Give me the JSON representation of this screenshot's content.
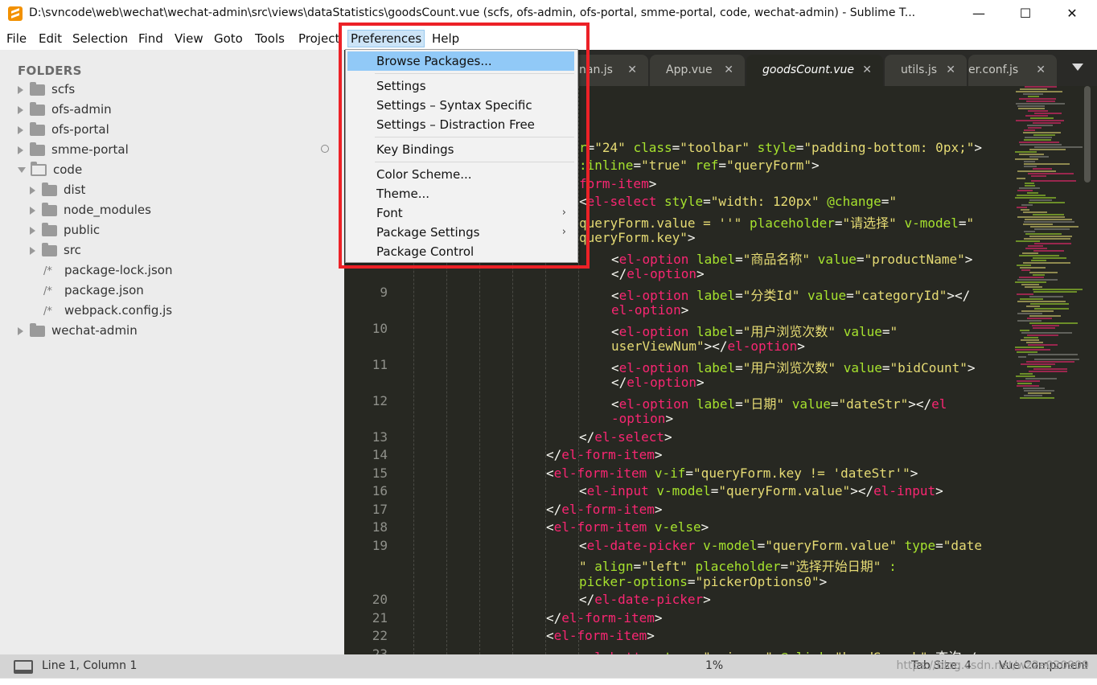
{
  "window": {
    "title": "D:\\svncode\\web\\wechat\\wechat-admin\\src\\views\\dataStatistics\\goodsCount.vue (scfs, ofs-admin, ofs-portal, smme-portal, code, wechat-admin) - Sublime T...",
    "minimize": "—",
    "maximize": "☐",
    "close": "✕"
  },
  "menubar": {
    "items": [
      "File",
      "Edit",
      "Selection",
      "Find",
      "View",
      "Goto",
      "Tools",
      "Project",
      "Preferences",
      "Help"
    ]
  },
  "sidebar": {
    "header": "FOLDERS",
    "items": [
      {
        "label": "scfs",
        "type": "folder"
      },
      {
        "label": "ofs-admin",
        "type": "folder"
      },
      {
        "label": "ofs-portal",
        "type": "folder"
      },
      {
        "label": "smme-portal",
        "type": "folder"
      },
      {
        "label": "code",
        "type": "folder-open"
      },
      {
        "label": "dist",
        "type": "folder"
      },
      {
        "label": "node_modules",
        "type": "folder"
      },
      {
        "label": "public",
        "type": "folder"
      },
      {
        "label": "src",
        "type": "folder"
      },
      {
        "label": "package-lock.json",
        "type": "file"
      },
      {
        "label": "package.json",
        "type": "file"
      },
      {
        "label": "webpack.config.js",
        "type": "file"
      },
      {
        "label": "wechat-admin",
        "type": "folder"
      }
    ],
    "file_mark": "/*"
  },
  "tabs": [
    {
      "label": "main.js",
      "visible": "nan.js"
    },
    {
      "label": "App.vue"
    },
    {
      "label": "goodsCount.vue",
      "active": true
    },
    {
      "label": "utils.js"
    },
    {
      "label": "er.conf.js"
    }
  ],
  "tab_close": "✕",
  "preferences_menu": {
    "items": [
      {
        "label": "Browse Packages...",
        "highlighted": true
      },
      {
        "label": "Settings"
      },
      {
        "label": "Settings – Syntax Specific"
      },
      {
        "label": "Settings – Distraction Free"
      },
      {
        "label": "Key Bindings"
      },
      {
        "label": "Color Scheme..."
      },
      {
        "label": "Theme..."
      },
      {
        "label": "Font",
        "submenu": true
      },
      {
        "label": "Package Settings",
        "submenu": true
      },
      {
        "label": "Package Control"
      }
    ],
    "submenu_arrow": "›"
  },
  "editor": {
    "line_numbers": [
      "9",
      "10",
      "11",
      "12",
      "13",
      "14",
      "15",
      "16",
      "17",
      "18",
      "19",
      "20",
      "21",
      "22",
      "23"
    ]
  },
  "statusbar": {
    "position": "Line 1, Column 1",
    "zoom": "1%",
    "tab_size": "Tab Size: 4",
    "syntax": "Vue Component",
    "watermark": "https://blog.csdn.net/wz2e020909"
  },
  "colors": {
    "editor_bg": "#272822",
    "tag": "#f92672",
    "attr": "#a6e22e",
    "string": "#e6db74",
    "highlight_box": "#ec2127",
    "menu_highlight": "#91c9f7"
  }
}
